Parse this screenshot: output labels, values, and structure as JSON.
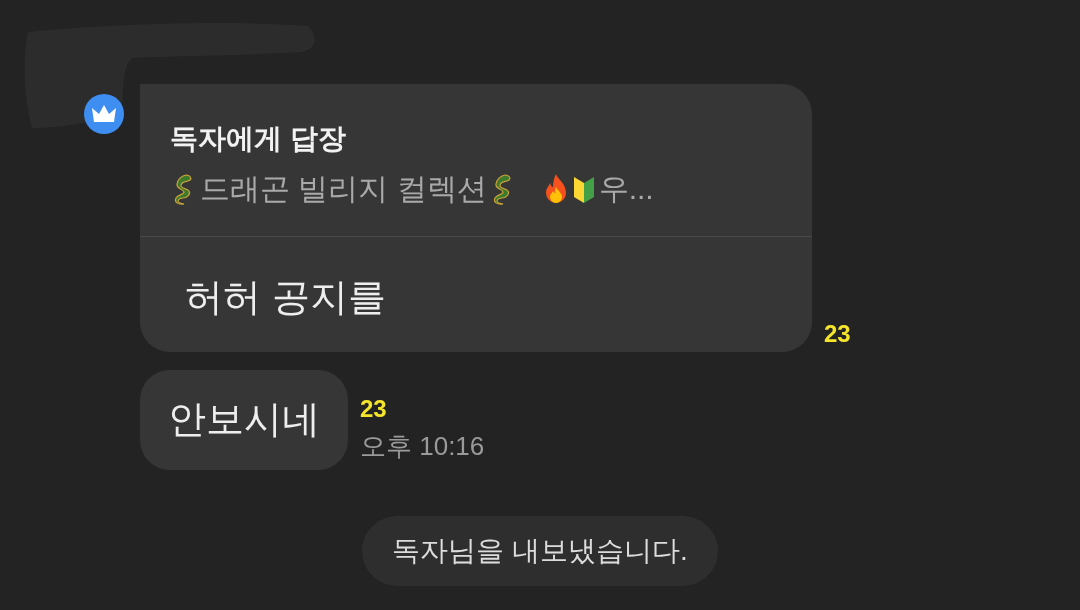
{
  "messages": [
    {
      "kind": "reply",
      "reply_title": "독자에게 답장",
      "quote": [
        {
          "kind": "dragon"
        },
        {
          "kind": "text",
          "text": "드래곤 빌리지 컬렉션"
        },
        {
          "kind": "dragon"
        },
        {
          "kind": "fire"
        },
        {
          "kind": "beginner"
        },
        {
          "kind": "text",
          "text": "우..."
        }
      ],
      "text": "허허 공지를",
      "unread": "23"
    },
    {
      "kind": "plain",
      "text": "안보시네",
      "unread": "23",
      "time": "오후 10:16"
    }
  ],
  "system_notice": "독자님을 내보냈습니다."
}
